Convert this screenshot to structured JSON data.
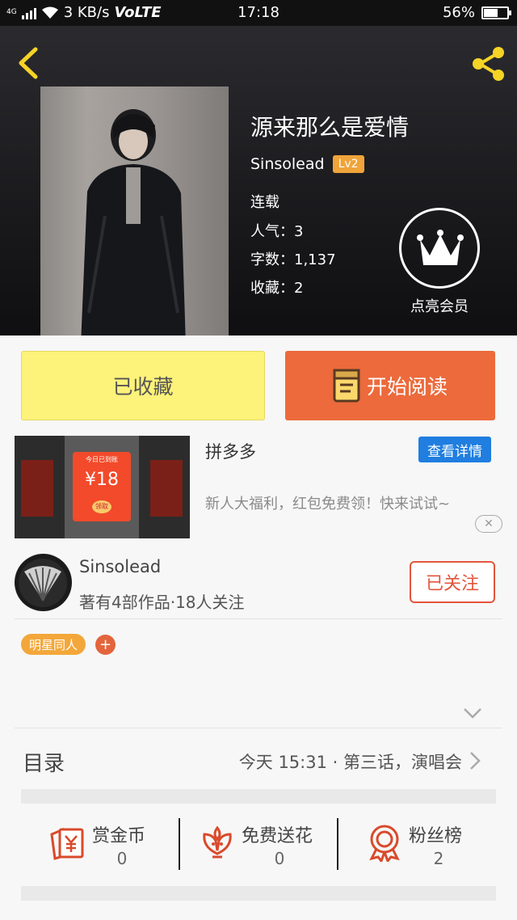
{
  "status_bar": {
    "network": "4G",
    "speed": "3 KB/s",
    "volte": "VoLTE",
    "time": "17:18",
    "battery_percent": "56%",
    "battery_level": 0.56
  },
  "book": {
    "title": "源来那么是爱情",
    "author": "Sinsolead",
    "level": "Lv2",
    "status": "连载",
    "popularity": "人气：3",
    "word_count": "字数：1,137",
    "favorites": "收藏：2"
  },
  "vip": {
    "label": "点亮会员"
  },
  "actions": {
    "collected_label": "已收藏",
    "read_label": "开始阅读"
  },
  "ad": {
    "title": "拼多多",
    "detail_button": "查看详情",
    "description": "新人大福利，红包免费领！快来试试~",
    "close": "✕",
    "image": {
      "header": "今日已到账",
      "amount": "¥18",
      "claim": "领取"
    }
  },
  "author_card": {
    "name": "Sinsolead",
    "subtitle": "著有4部作品·18人关注",
    "follow_label": "已关注"
  },
  "tags": {
    "items": [
      "明星同人"
    ],
    "add_label": "+"
  },
  "catalog": {
    "label": "目录",
    "latest": "今天 15:31 · 第三话，演唱会"
  },
  "stats": [
    {
      "icon": "red-envelope-yen-icon",
      "label": "赏金币",
      "value": "0"
    },
    {
      "icon": "flower-icon",
      "label": "免费送花",
      "value": "0"
    },
    {
      "icon": "award-ribbon-icon",
      "label": "粉丝榜",
      "value": "2"
    }
  ],
  "colors": {
    "accent_orange": "#ec6a3c",
    "collected_yellow": "#fdf27a",
    "level_badge": "#f0a43a",
    "detail_blue": "#1f7ee0",
    "icon_red": "#d94a2b",
    "share_yellow": "#f5d426"
  }
}
